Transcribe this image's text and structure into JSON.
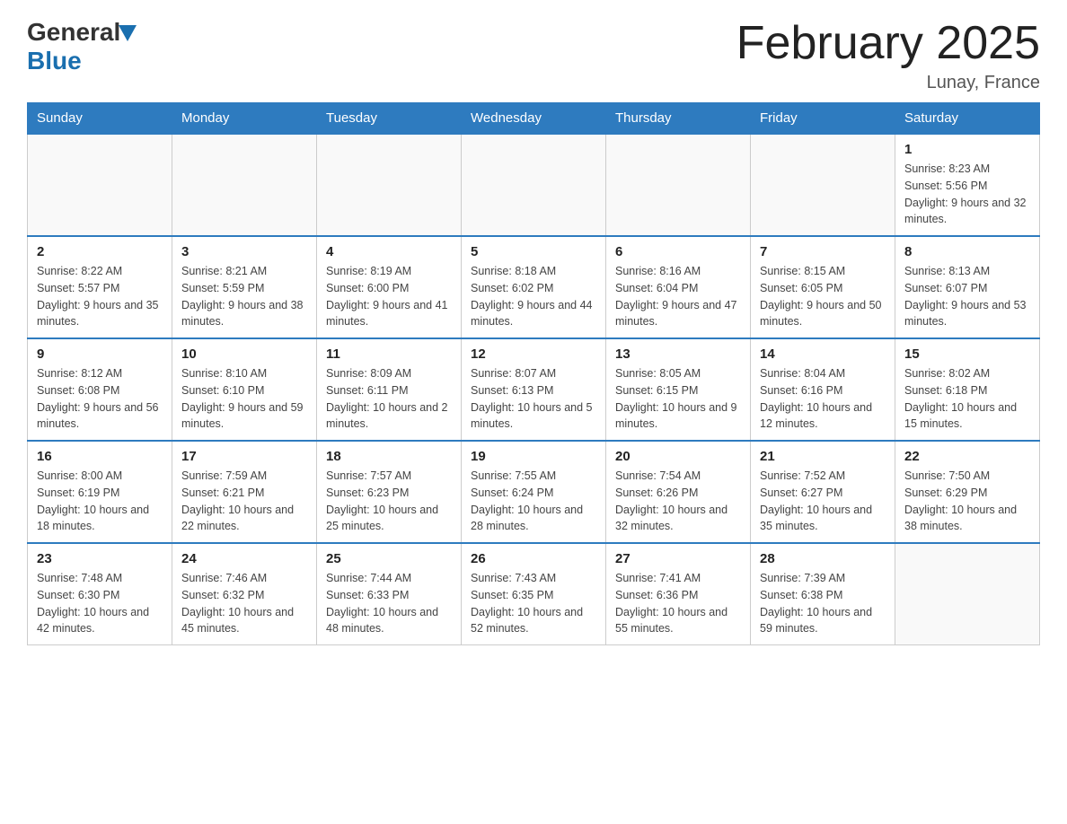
{
  "header": {
    "logo_general": "General",
    "logo_blue": "Blue",
    "month_title": "February 2025",
    "location": "Lunay, France"
  },
  "days_of_week": [
    "Sunday",
    "Monday",
    "Tuesday",
    "Wednesday",
    "Thursday",
    "Friday",
    "Saturday"
  ],
  "weeks": [
    [
      {
        "day": "",
        "info": ""
      },
      {
        "day": "",
        "info": ""
      },
      {
        "day": "",
        "info": ""
      },
      {
        "day": "",
        "info": ""
      },
      {
        "day": "",
        "info": ""
      },
      {
        "day": "",
        "info": ""
      },
      {
        "day": "1",
        "info": "Sunrise: 8:23 AM\nSunset: 5:56 PM\nDaylight: 9 hours and 32 minutes."
      }
    ],
    [
      {
        "day": "2",
        "info": "Sunrise: 8:22 AM\nSunset: 5:57 PM\nDaylight: 9 hours and 35 minutes."
      },
      {
        "day": "3",
        "info": "Sunrise: 8:21 AM\nSunset: 5:59 PM\nDaylight: 9 hours and 38 minutes."
      },
      {
        "day": "4",
        "info": "Sunrise: 8:19 AM\nSunset: 6:00 PM\nDaylight: 9 hours and 41 minutes."
      },
      {
        "day": "5",
        "info": "Sunrise: 8:18 AM\nSunset: 6:02 PM\nDaylight: 9 hours and 44 minutes."
      },
      {
        "day": "6",
        "info": "Sunrise: 8:16 AM\nSunset: 6:04 PM\nDaylight: 9 hours and 47 minutes."
      },
      {
        "day": "7",
        "info": "Sunrise: 8:15 AM\nSunset: 6:05 PM\nDaylight: 9 hours and 50 minutes."
      },
      {
        "day": "8",
        "info": "Sunrise: 8:13 AM\nSunset: 6:07 PM\nDaylight: 9 hours and 53 minutes."
      }
    ],
    [
      {
        "day": "9",
        "info": "Sunrise: 8:12 AM\nSunset: 6:08 PM\nDaylight: 9 hours and 56 minutes."
      },
      {
        "day": "10",
        "info": "Sunrise: 8:10 AM\nSunset: 6:10 PM\nDaylight: 9 hours and 59 minutes."
      },
      {
        "day": "11",
        "info": "Sunrise: 8:09 AM\nSunset: 6:11 PM\nDaylight: 10 hours and 2 minutes."
      },
      {
        "day": "12",
        "info": "Sunrise: 8:07 AM\nSunset: 6:13 PM\nDaylight: 10 hours and 5 minutes."
      },
      {
        "day": "13",
        "info": "Sunrise: 8:05 AM\nSunset: 6:15 PM\nDaylight: 10 hours and 9 minutes."
      },
      {
        "day": "14",
        "info": "Sunrise: 8:04 AM\nSunset: 6:16 PM\nDaylight: 10 hours and 12 minutes."
      },
      {
        "day": "15",
        "info": "Sunrise: 8:02 AM\nSunset: 6:18 PM\nDaylight: 10 hours and 15 minutes."
      }
    ],
    [
      {
        "day": "16",
        "info": "Sunrise: 8:00 AM\nSunset: 6:19 PM\nDaylight: 10 hours and 18 minutes."
      },
      {
        "day": "17",
        "info": "Sunrise: 7:59 AM\nSunset: 6:21 PM\nDaylight: 10 hours and 22 minutes."
      },
      {
        "day": "18",
        "info": "Sunrise: 7:57 AM\nSunset: 6:23 PM\nDaylight: 10 hours and 25 minutes."
      },
      {
        "day": "19",
        "info": "Sunrise: 7:55 AM\nSunset: 6:24 PM\nDaylight: 10 hours and 28 minutes."
      },
      {
        "day": "20",
        "info": "Sunrise: 7:54 AM\nSunset: 6:26 PM\nDaylight: 10 hours and 32 minutes."
      },
      {
        "day": "21",
        "info": "Sunrise: 7:52 AM\nSunset: 6:27 PM\nDaylight: 10 hours and 35 minutes."
      },
      {
        "day": "22",
        "info": "Sunrise: 7:50 AM\nSunset: 6:29 PM\nDaylight: 10 hours and 38 minutes."
      }
    ],
    [
      {
        "day": "23",
        "info": "Sunrise: 7:48 AM\nSunset: 6:30 PM\nDaylight: 10 hours and 42 minutes."
      },
      {
        "day": "24",
        "info": "Sunrise: 7:46 AM\nSunset: 6:32 PM\nDaylight: 10 hours and 45 minutes."
      },
      {
        "day": "25",
        "info": "Sunrise: 7:44 AM\nSunset: 6:33 PM\nDaylight: 10 hours and 48 minutes."
      },
      {
        "day": "26",
        "info": "Sunrise: 7:43 AM\nSunset: 6:35 PM\nDaylight: 10 hours and 52 minutes."
      },
      {
        "day": "27",
        "info": "Sunrise: 7:41 AM\nSunset: 6:36 PM\nDaylight: 10 hours and 55 minutes."
      },
      {
        "day": "28",
        "info": "Sunrise: 7:39 AM\nSunset: 6:38 PM\nDaylight: 10 hours and 59 minutes."
      },
      {
        "day": "",
        "info": ""
      }
    ]
  ]
}
